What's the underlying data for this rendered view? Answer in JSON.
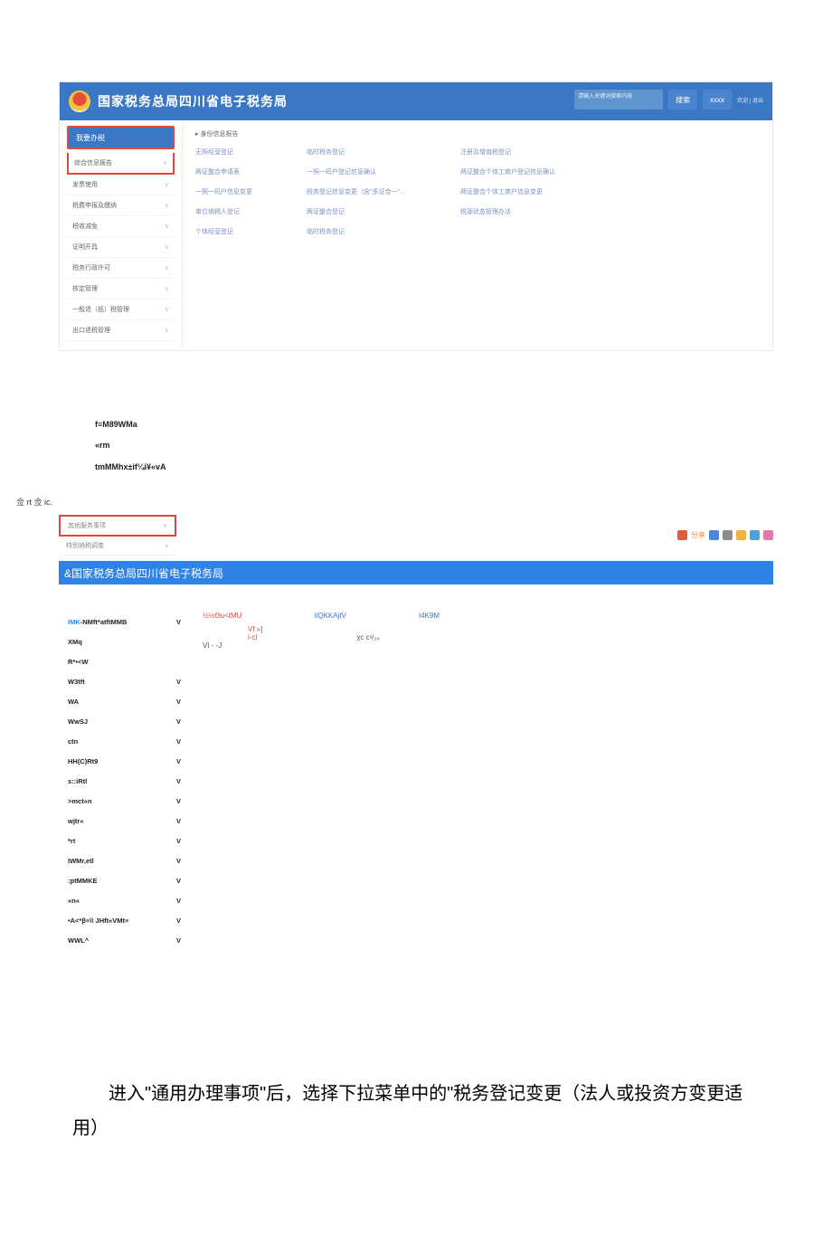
{
  "header1": {
    "title": "国家税务总局四川省电子税务局",
    "search_placeholder": "请输入关键词搜索内容",
    "search_btn": "搜索",
    "user_area": "xxxx",
    "info": "欢迎 | 退出"
  },
  "sidebar1": {
    "top": "我要办税",
    "items": [
      {
        "label": "综合信息报告",
        "chev": "∧"
      },
      {
        "label": "发票使用",
        "chev": "∨"
      },
      {
        "label": "税费申报及缴纳",
        "chev": "∨"
      },
      {
        "label": "税收减免",
        "chev": "∨"
      },
      {
        "label": "证明开具",
        "chev": "∨"
      },
      {
        "label": "税务行政许可",
        "chev": "∨"
      },
      {
        "label": "核定管理",
        "chev": "∨"
      },
      {
        "label": "一般退（抵）税管理",
        "chev": "∨"
      },
      {
        "label": "出口退税管理",
        "chev": "∨"
      }
    ]
  },
  "content1": {
    "heading": "▸ 身份信息报告",
    "cols": [
      [
        "无照经营登记",
        "两证整合申请表",
        "一照一码户信息变更",
        "单位纳税人登记",
        "个体经营登记"
      ],
      [
        "临时税务登记",
        "一照一码户登记信息确认",
        "税务登记信息变更（含\"多证合一\"…",
        "两证整合登记",
        "临时税务登记"
      ],
      [
        "注册及增值税登记",
        "两证整合个体工商户登记信息确认",
        "两证整合个体工商户信息变更",
        "税源状态管理办法"
      ]
    ]
  },
  "garble": {
    "l1": "f≡M89WMa",
    "l2": "«rm",
    "l3": "tmMMhx±if¼i¥«vA"
  },
  "left_label": "佥 rt 佥 ic.",
  "dd1": "其他服务事项",
  "dd2": "特别纳税调查",
  "share_text": "分享",
  "header2": "&国家税务总局四川省电子税务局",
  "sidebar2": [
    {
      "blue": "IMK",
      "rest": "-NMft*atftMMB",
      "v": "V"
    },
    {
      "rest": "XMq",
      "v": ""
    },
    {
      "rest": "R*•<W",
      "v": ""
    },
    {
      "rest": "W3tft",
      "v": "V"
    },
    {
      "rest": "WA",
      "v": "V"
    },
    {
      "rest": "WwSJ",
      "v": "V"
    },
    {
      "rest": "ctn",
      "v": "V"
    },
    {
      "rest": "HH(C)Rt9",
      "v": "V"
    },
    {
      "rest": "s::iRtl",
      "v": "V"
    },
    {
      "rest": ">mct«n",
      "v": "V"
    },
    {
      "rest": "wjtr«",
      "v": "V"
    },
    {
      "rest": "*rt",
      "v": "V"
    },
    {
      "rest": "IWMr,etl",
      "v": "V"
    },
    {
      "rest": ":ptMMKE",
      "v": "V"
    },
    {
      "rest": "«n«",
      "v": "V"
    },
    {
      "rest": "•A<*β≡\\\\ JHft«VMt≡",
      "v": "V"
    },
    {
      "rest": "WWL^",
      "v": "V"
    }
  ],
  "content2": {
    "r1": {
      "a": "½½Θu<tMU",
      "b": "iIQKKAjtV",
      "c": "I4K9M"
    },
    "r2": {
      "a": "Vf    »]",
      "b": "",
      "c": ""
    },
    "r3": {
      "a": "i-cl",
      "b": "χc c¹/₂₈",
      "c": ""
    },
    "r4": {
      "a": "VI - -J",
      "b": "",
      "c": ""
    }
  },
  "paragraph": "进入\"通用办理事项\"后，选择下拉菜单中的\"税务登记变更（法人或投资方变更适用）"
}
